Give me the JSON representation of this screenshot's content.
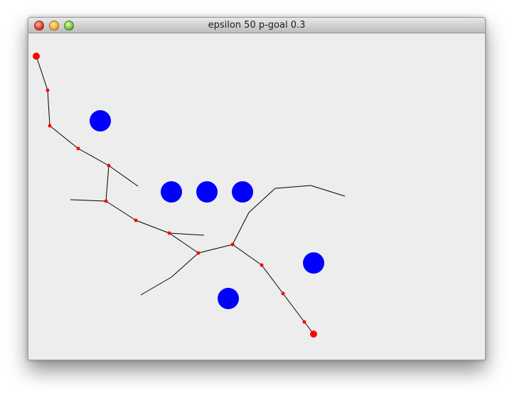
{
  "window": {
    "title": "epsilon 50 p-goal 0.3",
    "background": "#ededed"
  },
  "colors": {
    "obstacle": "#0000ff",
    "node": "#ff0000",
    "edge": "#000000"
  },
  "traffic_lights": [
    "close",
    "minimize",
    "zoom"
  ]
}
